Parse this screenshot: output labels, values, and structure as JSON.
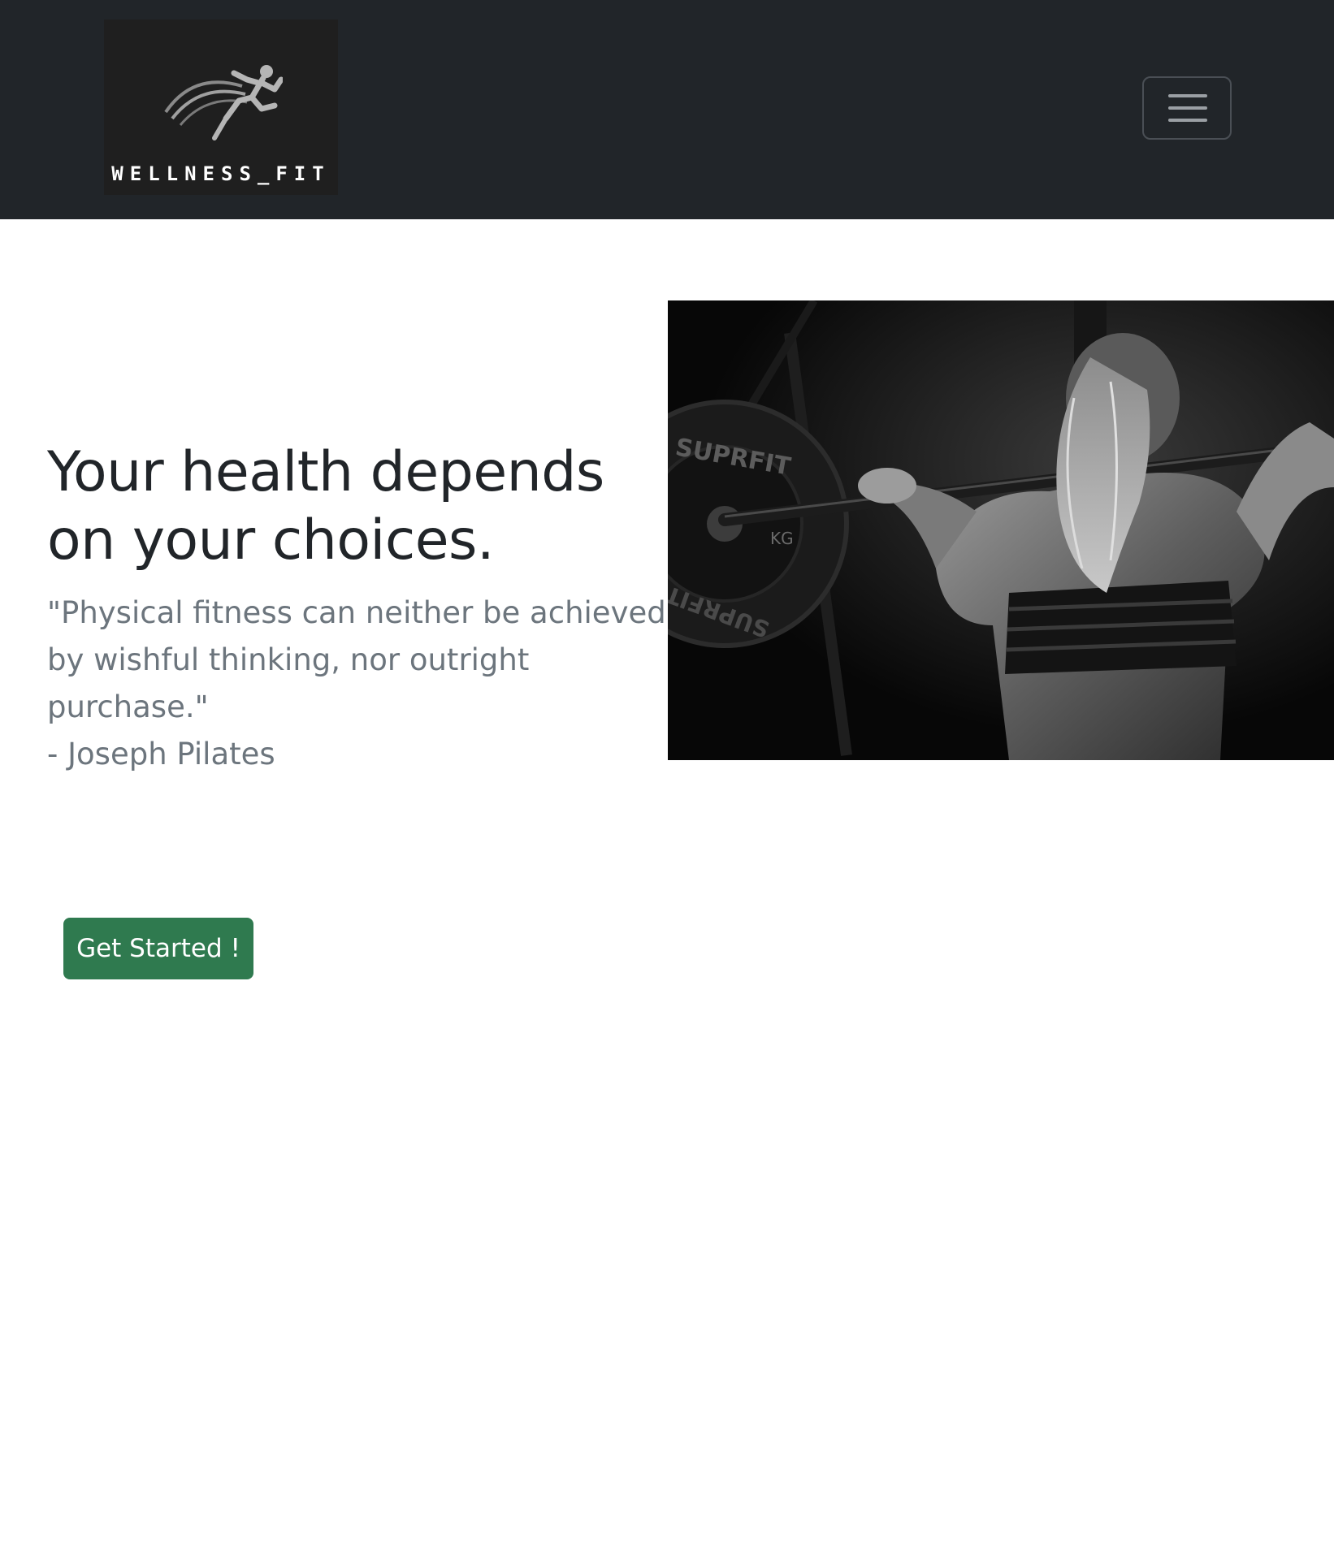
{
  "header": {
    "logo_text": "WELLNESS_FIT",
    "logo_icon": "running-person-icon",
    "menu_icon": "hamburger-menu-icon",
    "background_color": "#212529"
  },
  "hero": {
    "title": "Your health depends on your choices.",
    "quote_line1": "\"Physical fitness can neither be achieved",
    "quote_line2": "by wishful thinking, nor outright purchase.\"",
    "quote_line3": "- Joseph Pilates",
    "image_plate_text_top": "SUPRFIT",
    "image_plate_text_mid": "KG",
    "image_plate_text_bottom": "SUPRFIT"
  },
  "cta": {
    "label": "Get Started !",
    "color": "#2f7a4f"
  }
}
